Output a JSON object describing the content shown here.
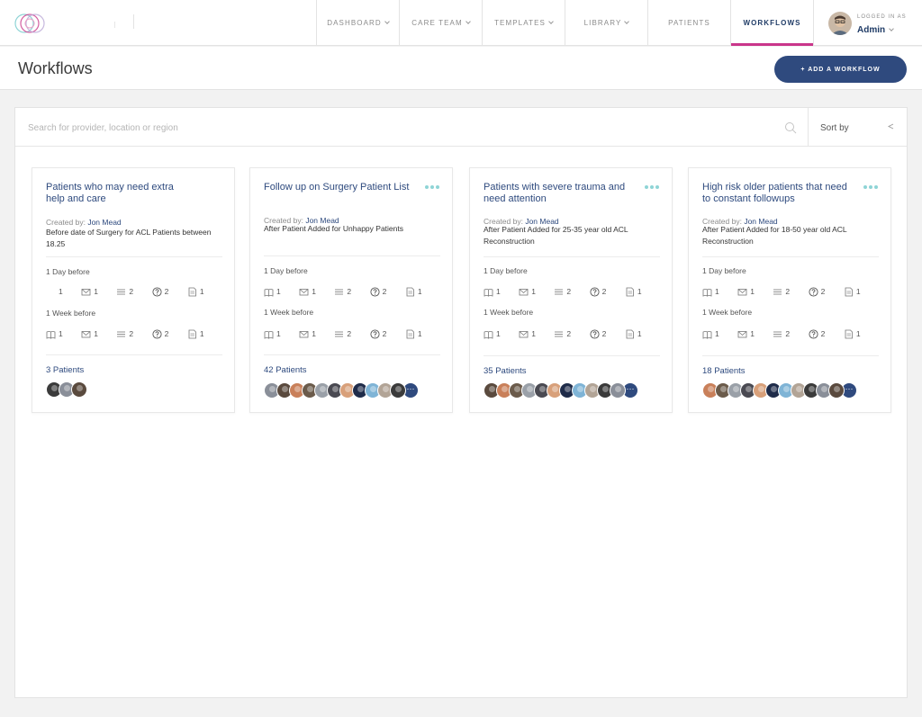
{
  "nav": {
    "items": [
      {
        "label": "Dashboard",
        "chevron": true,
        "active": false
      },
      {
        "label": "Care Team",
        "chevron": true,
        "active": false
      },
      {
        "label": "Templates",
        "chevron": true,
        "active": false
      },
      {
        "label": "Library",
        "chevron": true,
        "active": false
      },
      {
        "label": "Patients",
        "chevron": false,
        "active": false
      },
      {
        "label": "Workflows",
        "chevron": false,
        "active": true
      }
    ],
    "accent": "#c9368a"
  },
  "user": {
    "caption": "Logged in as",
    "name": "Admin"
  },
  "page": {
    "title": "Workflows",
    "add_button": "+ Add a workflow"
  },
  "search": {
    "placeholder": "Search for provider, location or region",
    "value": ""
  },
  "sort": {
    "label": "Sort by"
  },
  "colors": {
    "brand": "#2f4a7e",
    "link": "#2e4a7e",
    "more_dots": "#8fd4d6"
  },
  "cards": [
    {
      "title": "Patients who may need extra help and care",
      "created_label": "Created by:",
      "author": "Jon Mead",
      "trigger": "Before date of Surgery for ACL Patients between 18.25",
      "has_more": false,
      "sections": [
        {
          "label": "1 Day before",
          "counts": [
            {
              "icon": "book-icon",
              "value": "1"
            },
            {
              "icon": "mail-icon",
              "value": "1"
            },
            {
              "icon": "list-icon",
              "value": "2"
            },
            {
              "icon": "question-icon",
              "value": "2"
            },
            {
              "icon": "document-icon",
              "value": "1"
            }
          ]
        },
        {
          "label": "1 Week before",
          "counts": [
            {
              "icon": "book-icon",
              "value": "1"
            },
            {
              "icon": "mail-icon",
              "value": "1"
            },
            {
              "icon": "list-icon",
              "value": "2"
            },
            {
              "icon": "question-icon",
              "value": "2"
            },
            {
              "icon": "document-icon",
              "value": "1"
            }
          ]
        }
      ],
      "patients": "3 Patients",
      "avatar_count": 3,
      "show_more_avatars": false
    },
    {
      "title": "Follow up on Surgery Patient List",
      "created_label": "Created by:",
      "author": "Jon Mead",
      "trigger": "After Patient Added for Unhappy Patients",
      "has_more": true,
      "sections": [
        {
          "label": "1 Day before",
          "counts": [
            {
              "icon": "book-icon",
              "value": "1"
            },
            {
              "icon": "mail-icon",
              "value": "1"
            },
            {
              "icon": "list-icon",
              "value": "2"
            },
            {
              "icon": "question-icon",
              "value": "2"
            },
            {
              "icon": "document-icon",
              "value": "1"
            }
          ]
        },
        {
          "label": "1 Week before",
          "counts": [
            {
              "icon": "book-icon",
              "value": "1"
            },
            {
              "icon": "mail-icon",
              "value": "1"
            },
            {
              "icon": "list-icon",
              "value": "2"
            },
            {
              "icon": "question-icon",
              "value": "2"
            },
            {
              "icon": "document-icon",
              "value": "1"
            }
          ]
        }
      ],
      "patients": "42 Patients",
      "avatar_count": 11,
      "show_more_avatars": true
    },
    {
      "title": "Patients with severe trauma and need attention",
      "created_label": "Created by:",
      "author": "Jon Mead",
      "trigger": "After Patient Added for 25-35 year old ACL Reconstruction",
      "has_more": true,
      "sections": [
        {
          "label": "1 Day before",
          "counts": [
            {
              "icon": "book-icon",
              "value": "1"
            },
            {
              "icon": "mail-icon",
              "value": "1"
            },
            {
              "icon": "list-icon",
              "value": "2"
            },
            {
              "icon": "question-icon",
              "value": "2"
            },
            {
              "icon": "document-icon",
              "value": "1"
            }
          ]
        },
        {
          "label": "1 Week before",
          "counts": [
            {
              "icon": "book-icon",
              "value": "1"
            },
            {
              "icon": "mail-icon",
              "value": "1"
            },
            {
              "icon": "list-icon",
              "value": "2"
            },
            {
              "icon": "question-icon",
              "value": "2"
            },
            {
              "icon": "document-icon",
              "value": "1"
            }
          ]
        }
      ],
      "patients": "35 Patients",
      "avatar_count": 11,
      "show_more_avatars": true
    },
    {
      "title": "High risk older patients that need to constant followups",
      "created_label": "Created by:",
      "author": "Jon Mead",
      "trigger": "After Patient Added for 18-50 year old ACL Reconstruction",
      "has_more": true,
      "sections": [
        {
          "label": "1 Day before",
          "counts": [
            {
              "icon": "book-icon",
              "value": "1"
            },
            {
              "icon": "mail-icon",
              "value": "1"
            },
            {
              "icon": "list-icon",
              "value": "2"
            },
            {
              "icon": "question-icon",
              "value": "2"
            },
            {
              "icon": "document-icon",
              "value": "1"
            }
          ]
        },
        {
          "label": "1 Week before",
          "counts": [
            {
              "icon": "book-icon",
              "value": "1"
            },
            {
              "icon": "mail-icon",
              "value": "1"
            },
            {
              "icon": "list-icon",
              "value": "2"
            },
            {
              "icon": "question-icon",
              "value": "2"
            },
            {
              "icon": "document-icon",
              "value": "1"
            }
          ]
        }
      ],
      "patients": "18 Patients",
      "avatar_count": 11,
      "show_more_avatars": true
    }
  ],
  "more_avatars_label": "···"
}
